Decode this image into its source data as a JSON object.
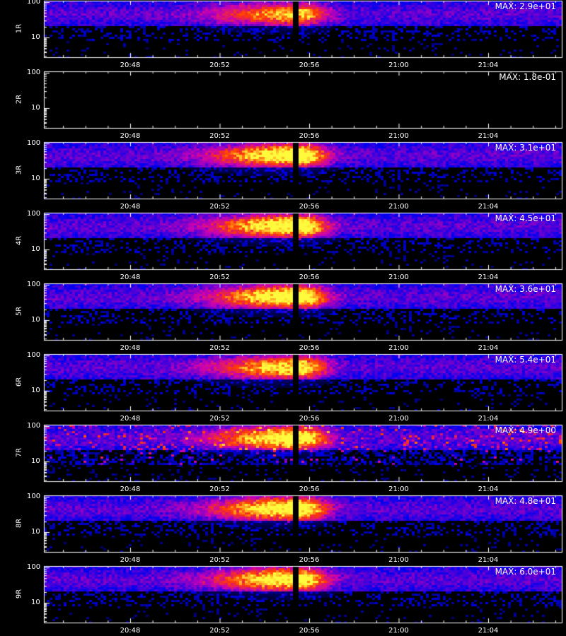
{
  "chart_data": [
    {
      "type": "heatmap",
      "panel": "1R",
      "y_ticks": [
        "100",
        "10"
      ],
      "x_ticks": [
        "20:48",
        "20:52",
        "20:56",
        "21:00",
        "21:04"
      ],
      "max_label": "MAX: 2.9e+01",
      "max_value": 29,
      "intensity": 0.62,
      "noise": 0.6,
      "empty": false
    },
    {
      "type": "heatmap",
      "panel": "2R",
      "y_ticks": [
        "100",
        "10"
      ],
      "x_ticks": [
        "20:48",
        "20:52",
        "20:56",
        "21:00",
        "21:04"
      ],
      "max_label": "MAX: 1.8e-01",
      "max_value": 0.18,
      "intensity": 0.0,
      "noise": 0.0,
      "empty": true
    },
    {
      "type": "heatmap",
      "panel": "3R",
      "y_ticks": [
        "100",
        "10"
      ],
      "x_ticks": [
        "20:48",
        "20:52",
        "20:56",
        "21:00",
        "21:04"
      ],
      "max_label": "MAX: 3.1e+01",
      "max_value": 31,
      "intensity": 0.95,
      "noise": 0.6,
      "empty": false
    },
    {
      "type": "heatmap",
      "panel": "4R",
      "y_ticks": [
        "100",
        "10"
      ],
      "x_ticks": [
        "20:48",
        "20:52",
        "20:56",
        "21:00",
        "21:04"
      ],
      "max_label": "MAX: 4.5e+01",
      "max_value": 45,
      "intensity": 0.95,
      "noise": 0.6,
      "empty": false
    },
    {
      "type": "heatmap",
      "panel": "5R",
      "y_ticks": [
        "100",
        "10"
      ],
      "x_ticks": [
        "20:48",
        "20:52",
        "20:56",
        "21:00",
        "21:04"
      ],
      "max_label": "MAX: 3.6e+01",
      "max_value": 36,
      "intensity": 0.95,
      "noise": 0.6,
      "empty": false
    },
    {
      "type": "heatmap",
      "panel": "6R",
      "y_ticks": [
        "100",
        "10"
      ],
      "x_ticks": [
        "20:48",
        "20:52",
        "20:56",
        "21:00",
        "21:04"
      ],
      "max_label": "MAX: 5.4e+01",
      "max_value": 54,
      "intensity": 0.78,
      "noise": 0.55,
      "empty": false
    },
    {
      "type": "heatmap",
      "panel": "7R",
      "y_ticks": [
        "100",
        "10"
      ],
      "x_ticks": [
        "20:48",
        "20:52",
        "20:56",
        "21:00",
        "21:04"
      ],
      "max_label": "MAX: 4.9e+00",
      "max_value": 4.9,
      "intensity": 0.9,
      "noise": 1.0,
      "empty": false
    },
    {
      "type": "heatmap",
      "panel": "8R",
      "y_ticks": [
        "100",
        "10"
      ],
      "x_ticks": [
        "20:48",
        "20:52",
        "20:56",
        "21:00",
        "21:04"
      ],
      "max_label": "MAX: 4.8e+01",
      "max_value": 48,
      "intensity": 0.95,
      "noise": 0.6,
      "empty": false
    },
    {
      "type": "heatmap",
      "panel": "9R",
      "y_ticks": [
        "100",
        "10"
      ],
      "x_ticks": [
        "20:48",
        "20:52",
        "20:56",
        "21:00",
        "21:04"
      ],
      "max_label": "MAX: 6.0e+01",
      "max_value": 60,
      "intensity": 0.9,
      "noise": 0.6,
      "empty": false
    }
  ]
}
